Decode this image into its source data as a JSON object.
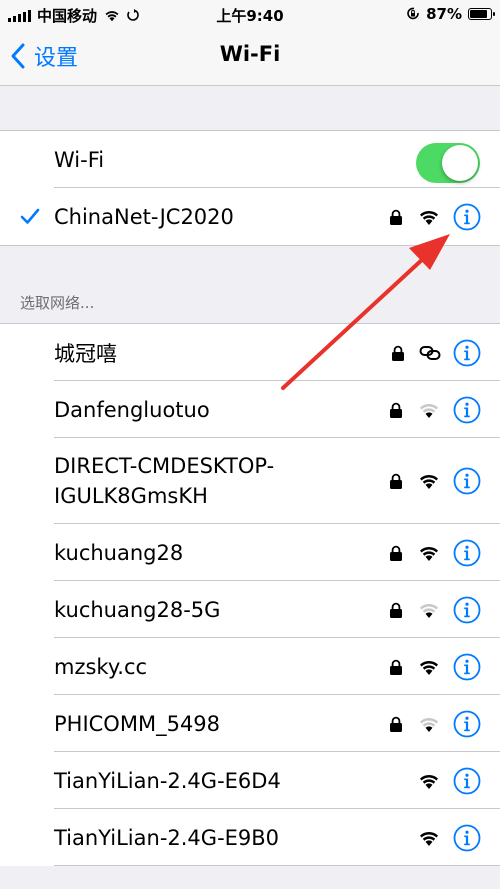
{
  "status_bar": {
    "carrier": "中国移动",
    "time": "上午9:40",
    "battery_percent": "87%",
    "battery_level": 0.87
  },
  "nav": {
    "back_label": "设置",
    "title": "Wi-Fi"
  },
  "wifi_toggle": {
    "label": "Wi-Fi",
    "on": true,
    "on_color": "#4cd964"
  },
  "connected_network": {
    "name": "ChinaNet-JC2020",
    "locked": true,
    "signal": "full"
  },
  "section_header": "选取网络...",
  "networks": [
    {
      "name": "城冠嘻",
      "locked": true,
      "signal": "hotspot-link"
    },
    {
      "name": "Danfengluotuo",
      "locked": true,
      "signal": "weak"
    },
    {
      "name_line1": "DIRECT-CMDESKTOP-",
      "name_line2": "IGULK8GmsKH",
      "locked": true,
      "signal": "full"
    },
    {
      "name": "kuchuang28",
      "locked": true,
      "signal": "full"
    },
    {
      "name": "kuchuang28-5G",
      "locked": true,
      "signal": "weak"
    },
    {
      "name": "mzsky.cc",
      "locked": true,
      "signal": "full"
    },
    {
      "name": "PHICOMM_5498",
      "locked": true,
      "signal": "weak"
    },
    {
      "name": "TianYiLian-2.4G-E6D4",
      "locked": false,
      "signal": "full"
    },
    {
      "name": "TianYiLian-2.4G-E9B0",
      "locked": false,
      "signal": "full"
    }
  ],
  "colors": {
    "accent": "#007aff",
    "annotation_arrow": "#e8322b"
  }
}
